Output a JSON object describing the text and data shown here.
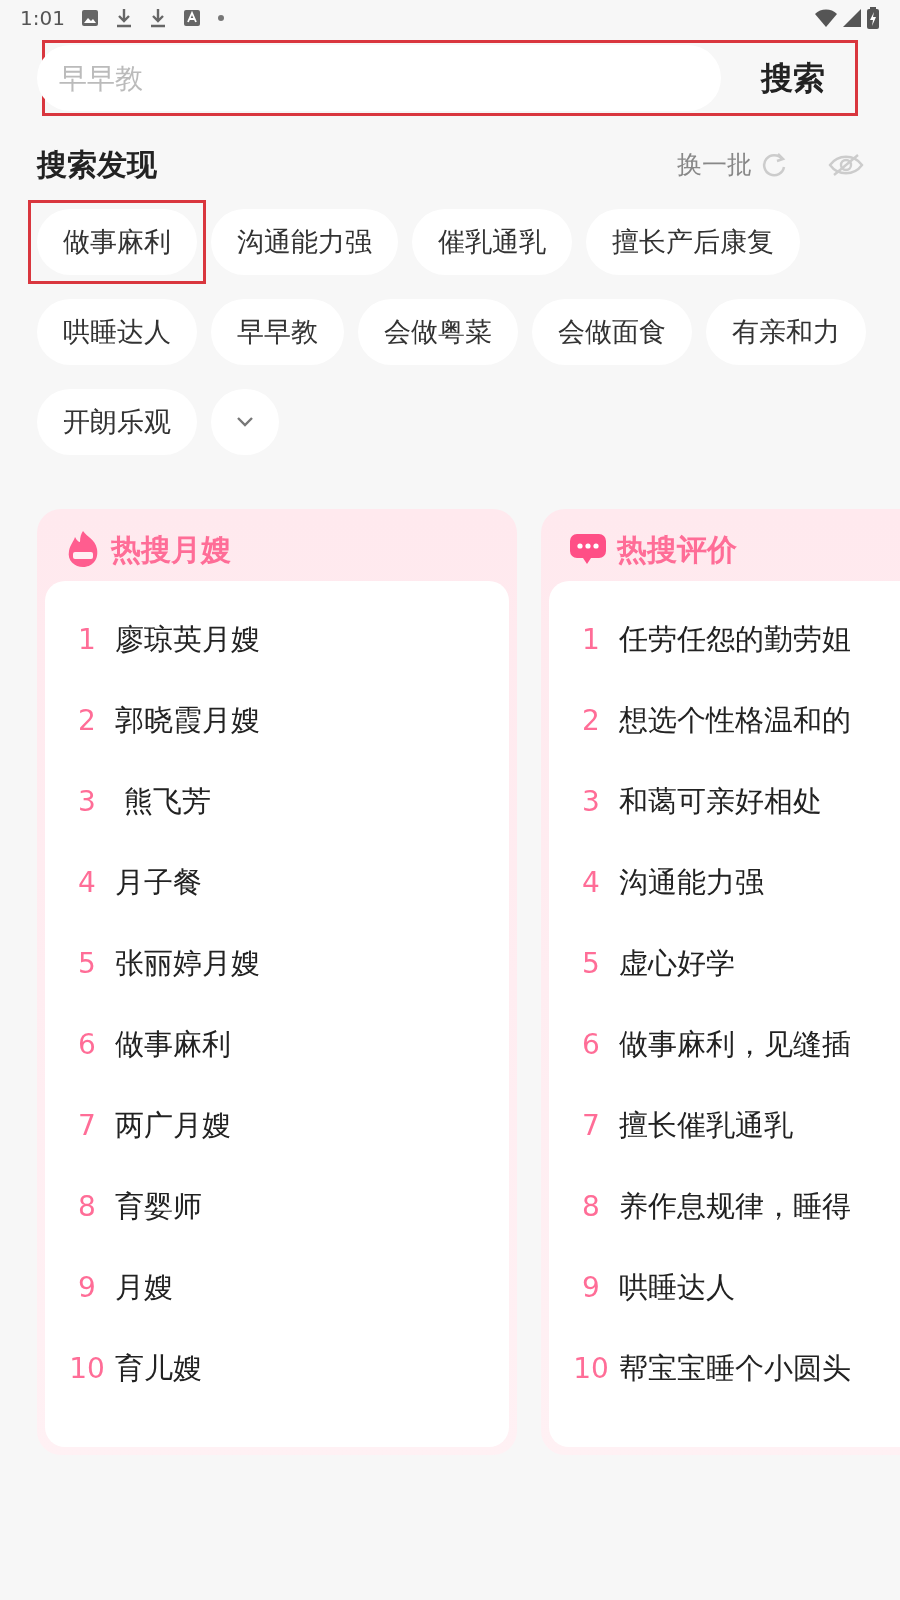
{
  "status_bar": {
    "time": "1:01"
  },
  "search": {
    "placeholder": "早早教",
    "button": "搜索",
    "highlighted": true
  },
  "discover": {
    "title": "搜索发现",
    "refresh": "换一批",
    "chips": [
      {
        "label": "做事麻利",
        "highlighted": true
      },
      {
        "label": "沟通能力强",
        "highlighted": false
      },
      {
        "label": "催乳通乳",
        "highlighted": false
      },
      {
        "label": "擅长产后康复",
        "highlighted": false
      },
      {
        "label": "哄睡达人",
        "highlighted": false
      },
      {
        "label": "早早教",
        "highlighted": false
      },
      {
        "label": "会做粤菜",
        "highlighted": false
      },
      {
        "label": "会做面食",
        "highlighted": false
      },
      {
        "label": "有亲和力",
        "highlighted": false
      },
      {
        "label": "开朗乐观",
        "highlighted": false
      }
    ]
  },
  "rankings": [
    {
      "kind": "top",
      "title": "热搜月嫂",
      "items": [
        {
          "rank": "1",
          "text": "廖琼英月嫂"
        },
        {
          "rank": "2",
          "text": "郭晓霞月嫂"
        },
        {
          "rank": "3",
          "text": " 熊飞芳"
        },
        {
          "rank": "4",
          "text": "月子餐"
        },
        {
          "rank": "5",
          "text": "张丽婷月嫂"
        },
        {
          "rank": "6",
          "text": "做事麻利"
        },
        {
          "rank": "7",
          "text": "两广月嫂"
        },
        {
          "rank": "8",
          "text": "育婴师"
        },
        {
          "rank": "9",
          "text": "月嫂"
        },
        {
          "rank": "10",
          "text": "育儿嫂"
        }
      ]
    },
    {
      "kind": "comment",
      "title": "热搜评价",
      "items": [
        {
          "rank": "1",
          "text": "任劳任怨的勤劳姐"
        },
        {
          "rank": "2",
          "text": "想选个性格温和的"
        },
        {
          "rank": "3",
          "text": "和蔼可亲好相处"
        },
        {
          "rank": "4",
          "text": "沟通能力强"
        },
        {
          "rank": "5",
          "text": "虚心好学"
        },
        {
          "rank": "6",
          "text": "做事麻利，见缝插"
        },
        {
          "rank": "7",
          "text": "擅长催乳通乳"
        },
        {
          "rank": "8",
          "text": "养作息规律，睡得"
        },
        {
          "rank": "9",
          "text": "哄睡达人"
        },
        {
          "rank": "10",
          "text": "帮宝宝睡个小圆头"
        }
      ]
    }
  ]
}
